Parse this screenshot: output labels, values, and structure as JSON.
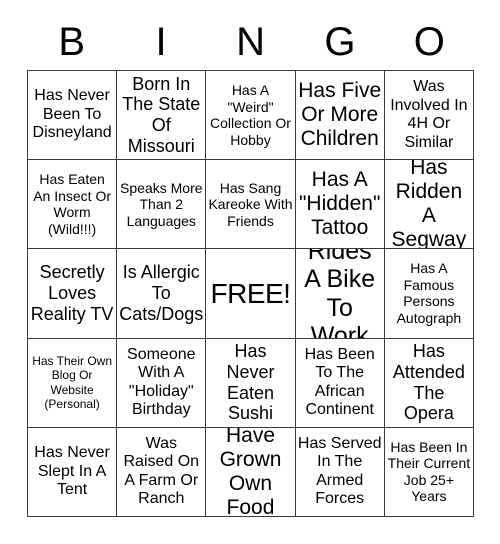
{
  "card": {
    "title": "BINGO",
    "header_letters": [
      "B",
      "I",
      "N",
      "G",
      "O"
    ],
    "columns": 5,
    "rows": 5,
    "free_space_index": 12,
    "border_color": "#3a3a3a",
    "background_color": "#ffffff",
    "text_color": "#000000"
  },
  "squares": [
    {
      "text": "Has Never Been To Disneyland",
      "size": "md"
    },
    {
      "text": "Born In The State Of Missouri",
      "size": "lg"
    },
    {
      "text": "Has A \"Weird\" Collection Or Hobby",
      "size": "sm"
    },
    {
      "text": "Has Five Or More Children",
      "size": "xl"
    },
    {
      "text": "Was Involved In 4H Or Similar",
      "size": "md"
    },
    {
      "text": "Has Eaten An Insect Or Worm (Wild!!!)",
      "size": "sm"
    },
    {
      "text": "Speaks More Than 2 Languages",
      "size": "sm"
    },
    {
      "text": "Has Sang Kareoke With Friends",
      "size": "sm"
    },
    {
      "text": "Has A \"Hidden\" Tattoo",
      "size": "xl"
    },
    {
      "text": "Has Ridden A Segway",
      "size": "xl"
    },
    {
      "text": "Secretly Loves Reality TV",
      "size": "lg"
    },
    {
      "text": "Is Allergic To Cats/Dogs",
      "size": "lg"
    },
    {
      "text": "FREE!",
      "size": "free"
    },
    {
      "text": "Rides A Bike To Work",
      "size": "xxl"
    },
    {
      "text": "Has A Famous Persons Autograph",
      "size": "sm"
    },
    {
      "text": "Has Their Own Blog Or Website (Personal)",
      "size": "xs"
    },
    {
      "text": "Someone With A \"Holiday\" Birthday",
      "size": "md"
    },
    {
      "text": "Has Never Eaten Sushi",
      "size": "lg"
    },
    {
      "text": "Has Been To The African Continent",
      "size": "md"
    },
    {
      "text": "Has Attended The Opera",
      "size": "lg"
    },
    {
      "text": "Has Never Slept In A Tent",
      "size": "md"
    },
    {
      "text": "Was Raised On A Farm Or Ranch",
      "size": "md"
    },
    {
      "text": "Have Grown Own Food",
      "size": "xl"
    },
    {
      "text": "Has Served In The Armed Forces",
      "size": "md"
    },
    {
      "text": "Has Been In Their Current Job 25+ Years",
      "size": "sm"
    }
  ]
}
